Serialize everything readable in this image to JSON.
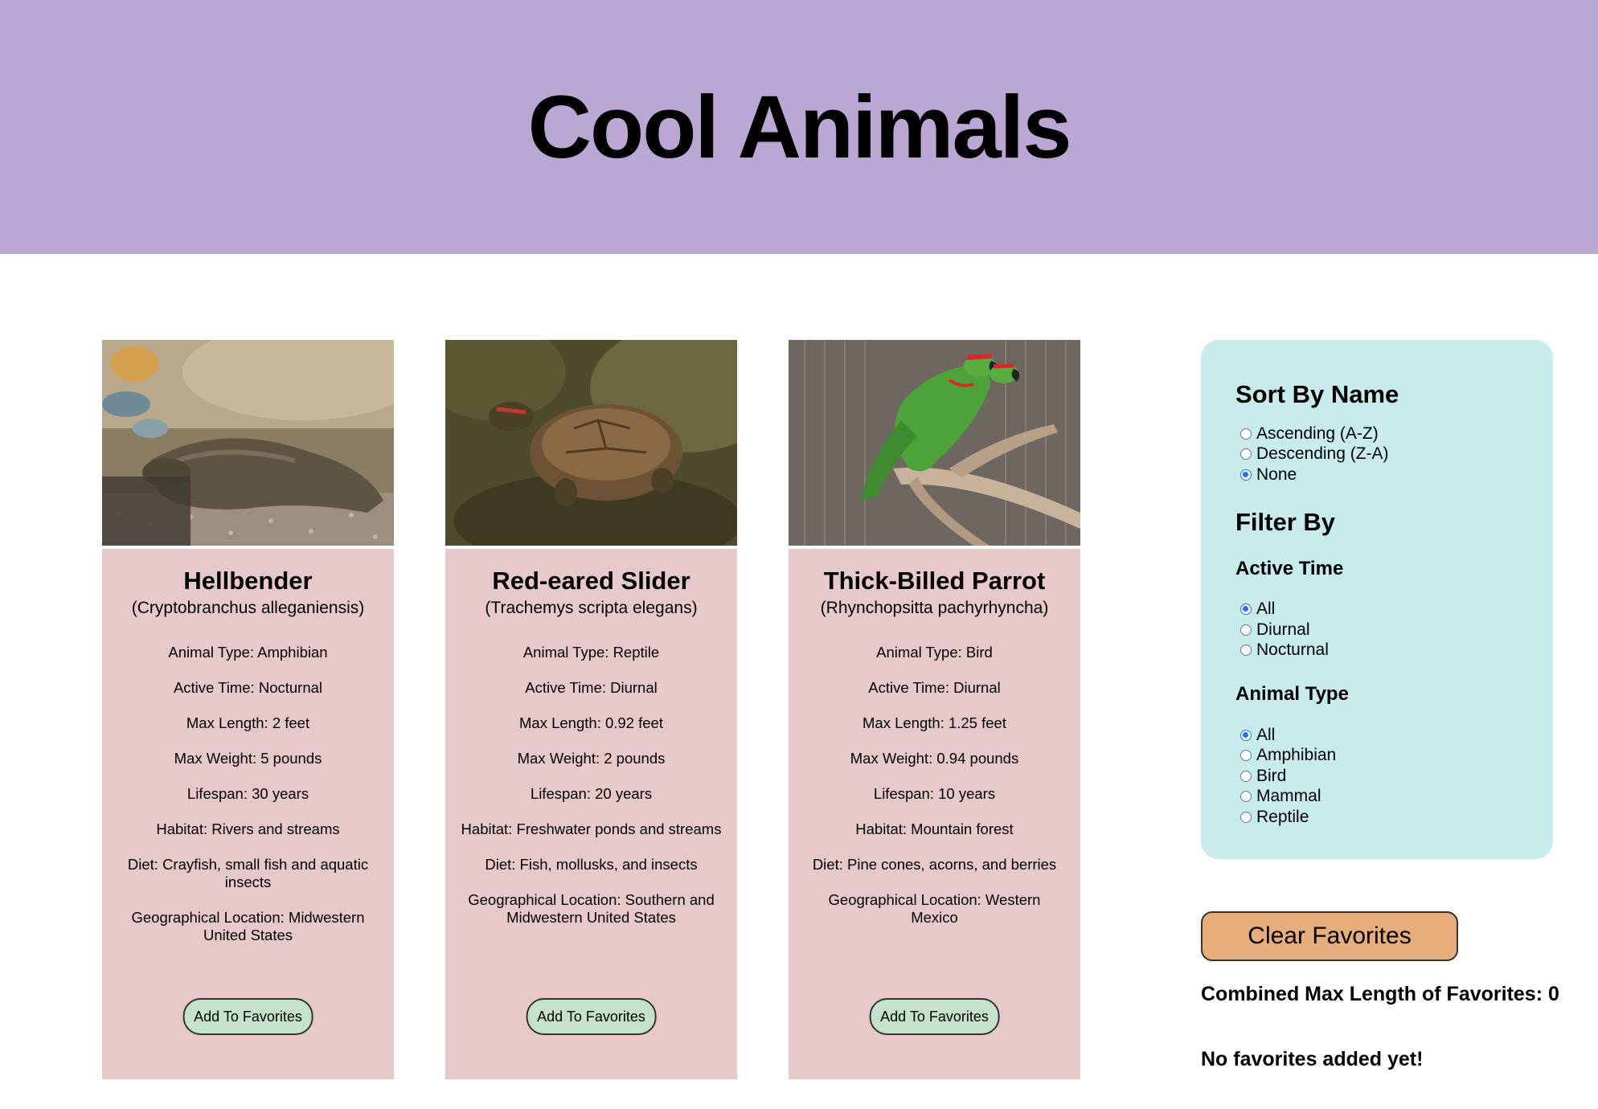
{
  "header": {
    "title": "Cool Animals"
  },
  "animals": [
    {
      "name": "Hellbender",
      "scientific": "(Cryptobranchus alleganiensis)",
      "facts": [
        "Animal Type: Amphibian",
        "Active Time: Nocturnal",
        "Max Length: 2 feet",
        "Max Weight: 5 pounds",
        "Lifespan: 30 years",
        "Habitat: Rivers and streams",
        "Diet: Crayfish, small fish and aquatic insects",
        "Geographical Location: Midwestern United States"
      ],
      "button": "Add To Favorites"
    },
    {
      "name": "Red-eared Slider",
      "scientific": "(Trachemys scripta elegans)",
      "facts": [
        "Animal Type: Reptile",
        "Active Time: Diurnal",
        "Max Length: 0.92 feet",
        "Max Weight: 2 pounds",
        "Lifespan: 20 years",
        "Habitat: Freshwater ponds and streams",
        "Diet: Fish, mollusks, and insects",
        "Geographical Location: Southern and Midwestern United States"
      ],
      "button": "Add To Favorites"
    },
    {
      "name": "Thick-Billed Parrot",
      "scientific": "(Rhynchopsitta pachyrhyncha)",
      "facts": [
        "Animal Type: Bird",
        "Active Time: Diurnal",
        "Max Length: 1.25 feet",
        "Max Weight: 0.94 pounds",
        "Lifespan: 10 years",
        "Habitat: Mountain forest",
        "Diet: Pine cones, acorns, and berries",
        "Geographical Location: Western Mexico"
      ],
      "button": "Add To Favorites"
    }
  ],
  "sidebar": {
    "sort_title": "Sort By Name",
    "sort_options": [
      "Ascending (A-Z)",
      "Descending (Z-A)",
      "None"
    ],
    "sort_selected": "None",
    "filter_title": "Filter By",
    "active_time_title": "Active Time",
    "active_time_options": [
      "All",
      "Diurnal",
      "Nocturnal"
    ],
    "active_time_selected": "All",
    "animal_type_title": "Animal Type",
    "animal_type_options": [
      "All",
      "Amphibian",
      "Bird",
      "Mammal",
      "Reptile"
    ],
    "animal_type_selected": "All"
  },
  "favorites": {
    "clear_label": "Clear Favorites",
    "combined_label": "Combined Max Length of Favorites: 0",
    "empty_message": "No favorites added yet!"
  },
  "colors": {
    "header_bg": "#bba7d4",
    "card_bg": "#e8c9cb",
    "sidebar_bg": "#c8ecec",
    "fav_button_bg": "#c5e3cb",
    "clear_button_bg": "#e8ad7c",
    "radio_accent": "#2f6fe0"
  }
}
